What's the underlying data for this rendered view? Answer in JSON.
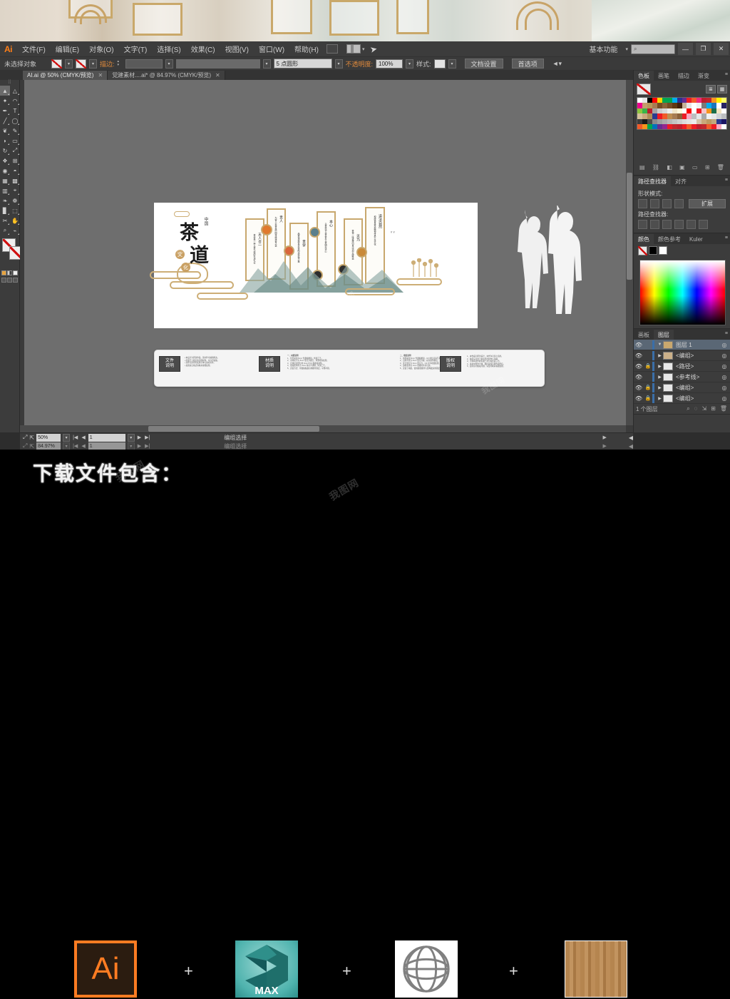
{
  "app": {
    "name": "Adobe Illustrator",
    "logo": "Ai",
    "workspace": "基本功能",
    "search_placeholder": ""
  },
  "menubar": {
    "items": [
      {
        "label": "文件(F)"
      },
      {
        "label": "编辑(E)"
      },
      {
        "label": "对象(O)"
      },
      {
        "label": "文字(T)"
      },
      {
        "label": "选择(S)"
      },
      {
        "label": "效果(C)"
      },
      {
        "label": "视图(V)"
      },
      {
        "label": "窗口(W)"
      },
      {
        "label": "帮助(H)"
      }
    ]
  },
  "window_controls": {
    "minimize": "—",
    "restore": "❐",
    "close": "✕"
  },
  "control_bar": {
    "selection_status": "未选择对象",
    "stroke_label": "描边:",
    "stroke_weight": "",
    "brush_value": "",
    "style_preset": "5 点圆形",
    "opacity_label": "不透明度:",
    "opacity_value": "100%",
    "style_label": "样式:",
    "document_setup": "文档设置",
    "preferences": "首选项"
  },
  "document_tabs": [
    {
      "label": "AI.ai @ 50% (CMYK/预览)",
      "active": true,
      "close": "✕"
    },
    {
      "label": "党建素材....ai* @ 84.97% (CMYK/预览)",
      "active": false,
      "close": "✕"
    }
  ],
  "toolbox": {
    "tools": [
      {
        "name": "selection-tool",
        "glyph": "▲"
      },
      {
        "name": "direct-selection-tool",
        "glyph": "△"
      },
      {
        "name": "magic-wand-tool",
        "glyph": "✦"
      },
      {
        "name": "lasso-tool",
        "glyph": "◠"
      },
      {
        "name": "pen-tool",
        "glyph": "✒"
      },
      {
        "name": "type-tool",
        "glyph": "T"
      },
      {
        "name": "line-segment-tool",
        "glyph": "╱"
      },
      {
        "name": "ellipse-tool",
        "glyph": "◯"
      },
      {
        "name": "paintbrush-tool",
        "glyph": "🖌"
      },
      {
        "name": "pencil-tool",
        "glyph": "✎"
      },
      {
        "name": "blob-brush-tool",
        "glyph": "◗"
      },
      {
        "name": "eraser-tool",
        "glyph": "▭"
      },
      {
        "name": "rotate-tool",
        "glyph": "↻"
      },
      {
        "name": "scale-tool",
        "glyph": "⤢"
      },
      {
        "name": "width-tool",
        "glyph": "❖"
      },
      {
        "name": "free-transform-tool",
        "glyph": "⊞"
      },
      {
        "name": "shape-builder-tool",
        "glyph": "◉"
      },
      {
        "name": "perspective-grid-tool",
        "glyph": "▦"
      },
      {
        "name": "mesh-tool",
        "glyph": "▩"
      },
      {
        "name": "gradient-tool",
        "glyph": "▥"
      },
      {
        "name": "eyedropper-tool",
        "glyph": "⌖"
      },
      {
        "name": "blend-tool",
        "glyph": "❧"
      },
      {
        "name": "symbol-sprayer-tool",
        "glyph": "❁"
      },
      {
        "name": "column-graph-tool",
        "glyph": "▊"
      },
      {
        "name": "artboard-tool",
        "glyph": "⬚"
      },
      {
        "name": "slice-tool",
        "glyph": "✂"
      },
      {
        "name": "hand-tool",
        "glyph": "✋"
      },
      {
        "name": "zoom-tool",
        "glyph": "🔍"
      }
    ]
  },
  "swatches_panel": {
    "tabs": [
      {
        "label": "色板",
        "active": true
      },
      {
        "label": "画笔",
        "active": false
      },
      {
        "label": "描边",
        "active": false
      },
      {
        "label": "渐变",
        "active": false
      }
    ],
    "colors": [
      "#ffffff",
      "#e8e8e8",
      "#000000",
      "#ff0000",
      "#ffd400",
      "#00a651",
      "#00a651",
      "#00aeef",
      "#2e3192",
      "#662d91",
      "#ed1c24",
      "#f15a29",
      "#ee2a7b",
      "#be1e2d",
      "#c1272d",
      "#f7941e",
      "#fff200",
      "#ffff66",
      "#ec008c",
      "#c69c6d",
      "#b5985a",
      "#a67c52",
      "#754c24",
      "#8c6239",
      "#754c24",
      "#603913",
      "#42210b",
      "#c7b299",
      "#e6e6e6",
      "#ffffff",
      "#f0f0f0",
      "#7a7a7a",
      "#00aeef",
      "#1b75bc",
      "#ffffff",
      "#262262",
      "#8dc63f",
      "#39b54a",
      "#be1e2d",
      "#a3a3a3",
      "#cccccc",
      "#d9d9d9",
      "#efefef",
      "#f1e6c8",
      "#fff8dc",
      "#ffffff",
      "#ff0000",
      "#ffffff",
      "#ed1c24",
      "#f7c5cb",
      "#f7941e",
      "#1b6e4a",
      "#f2e4c1",
      "#ffffff",
      "#d6c19a",
      "#caa97c",
      "#b08d57",
      "#2b3990",
      "#ed1c24",
      "#f15a29",
      "#be8e50",
      "#a67c52",
      "#8c6239",
      "#ed1c24",
      "#f9a8c0",
      "#bcbec0",
      "#e6e7e8",
      "#a7a9ac",
      "#f1f2f2",
      "#e6e7e8",
      "#d1d3d4",
      "#bcbec0",
      "#3b3b3b",
      "#1a1a1a",
      "#4d4d4d",
      "#8a8a8a",
      "#9e9e9e",
      "#ababab",
      "#b8b8b8",
      "#c4c4c4",
      "#d0d0d0",
      "#dcdcdc",
      "#e4e4e4",
      "#ececec",
      "#d4c2a8",
      "#c9a87a",
      "#bd9a63",
      "#c2aa7e",
      "#2b3990",
      "#1b1464",
      "#f15a29",
      "#f7941e",
      "#00a651",
      "#0071bc",
      "#662d91",
      "#92278f",
      "#ed1c24",
      "#c1272d",
      "#be1e2d",
      "#ed1c24",
      "#f15a29",
      "#ed1c24",
      "#be1e2d",
      "#c1272d",
      "#f15a29",
      "#ed1c24",
      "#f9a8c0",
      "#ffffff"
    ]
  },
  "pathfinder_panel": {
    "tabs": [
      {
        "label": "路径查找器",
        "active": true
      },
      {
        "label": "对齐",
        "active": false
      }
    ],
    "shape_modes_label": "形状模式:",
    "expand_label": "扩展",
    "pathfinders_label": "路径查找器:"
  },
  "color_panel": {
    "tabs": [
      {
        "label": "颜色",
        "active": true
      },
      {
        "label": "颜色参考",
        "active": false
      },
      {
        "label": "Kuler",
        "active": false
      }
    ]
  },
  "layers_panel": {
    "tabs": [
      {
        "label": "画板",
        "active": false
      },
      {
        "label": "图层",
        "active": true
      }
    ],
    "rows": [
      {
        "label": "图层 1",
        "selected": true,
        "locked": false,
        "expanded": true,
        "top": true
      },
      {
        "label": "<编组>",
        "selected": false,
        "locked": false,
        "expanded": false,
        "top": false
      },
      {
        "label": "<路径>",
        "selected": false,
        "locked": true,
        "expanded": false,
        "top": false
      },
      {
        "label": "<参考线>",
        "selected": false,
        "locked": false,
        "expanded": false,
        "top": false
      },
      {
        "label": "<编组>",
        "selected": false,
        "locked": true,
        "expanded": false,
        "top": false
      },
      {
        "label": "<编组>",
        "selected": false,
        "locked": true,
        "expanded": false,
        "top": false
      }
    ],
    "footer_count": "1 个图层"
  },
  "status_bar": {
    "zoom": "50%",
    "page": "1",
    "tool": "编组选择"
  },
  "artwork": {
    "title_cn": "中国",
    "title_main_1": "茶",
    "title_main_2": "道",
    "title_sub_1": "文",
    "title_sub_2": "化",
    "panels": [
      {
        "heading": "天人合一",
        "body": "茶道是一种以茶为媒的生活礼仪"
      },
      {
        "heading": "贵人",
        "body": "为客人奉茶是中国传统待客之道"
      },
      {
        "heading": "贵学",
        "body": "品茶悟道修身养性陶冶情操之美"
      },
      {
        "heading": "本心",
        "body": "以茶修德以茶会友以茶明志清心"
      },
      {
        "heading": "无为",
        "body": "茶禅一味返璞归真淡泊宁静致远"
      },
      {
        "heading": "道法自然",
        "body": "和静怡真茶道精神传承千年文化"
      }
    ],
    "info_bar": {
      "sections": [
        {
          "tag_line1": "文件",
          "tag_line2": "说明"
        },
        {
          "tag_line1": "材质",
          "tag_line2": "说明"
        },
        {
          "tag_line1": "版权",
          "tag_line2": "说明"
        }
      ],
      "col_headings": [
        "一、材质说明",
        "二、喷绘说明"
      ]
    }
  },
  "download_banner": {
    "title": "下载文件包含：",
    "separator": "+",
    "items": [
      {
        "name": "ai-file-icon",
        "label": "Ai"
      },
      {
        "name": "3dsmax-file-icon",
        "label": "MAX"
      },
      {
        "name": "model-file-icon",
        "label": ""
      },
      {
        "name": "texture-file-icon",
        "label": ""
      }
    ]
  },
  "watermark": {
    "text": "我图网"
  },
  "colors": {
    "accent_orange": "#ff7f18",
    "panel_bg": "#3c3c3c",
    "canvas_bg": "#6e6e6e",
    "artboard": "#ffffff",
    "layer_select": "#5a6775",
    "gold": "#c8a86e"
  }
}
